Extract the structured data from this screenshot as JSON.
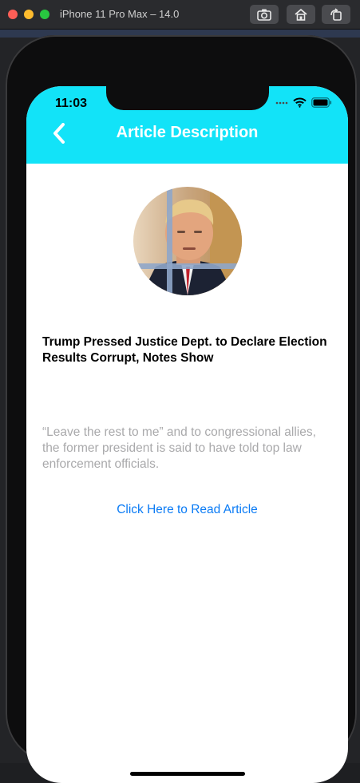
{
  "window": {
    "title": "iPhone 11 Pro Max – 14.0",
    "buttons": [
      "screenshot-icon",
      "home-icon",
      "rotate-icon"
    ]
  },
  "status_bar": {
    "time": "11:03",
    "icons": [
      "signal-icon",
      "wifi-icon",
      "battery-icon"
    ]
  },
  "nav": {
    "back_icon": "chevron-left-icon",
    "title": "Article Description",
    "background": "#12e3f8"
  },
  "article": {
    "image": "article-thumbnail",
    "headline": "Trump Pressed Justice Dept. to Declare Election Results Corrupt, Notes Show",
    "summary": "“Leave the rest to me” and to congressional allies, the former president is said to have told top law enforcement officials.",
    "link_label": "Click Here to Read Article",
    "link_color": "#0a7bf5"
  }
}
